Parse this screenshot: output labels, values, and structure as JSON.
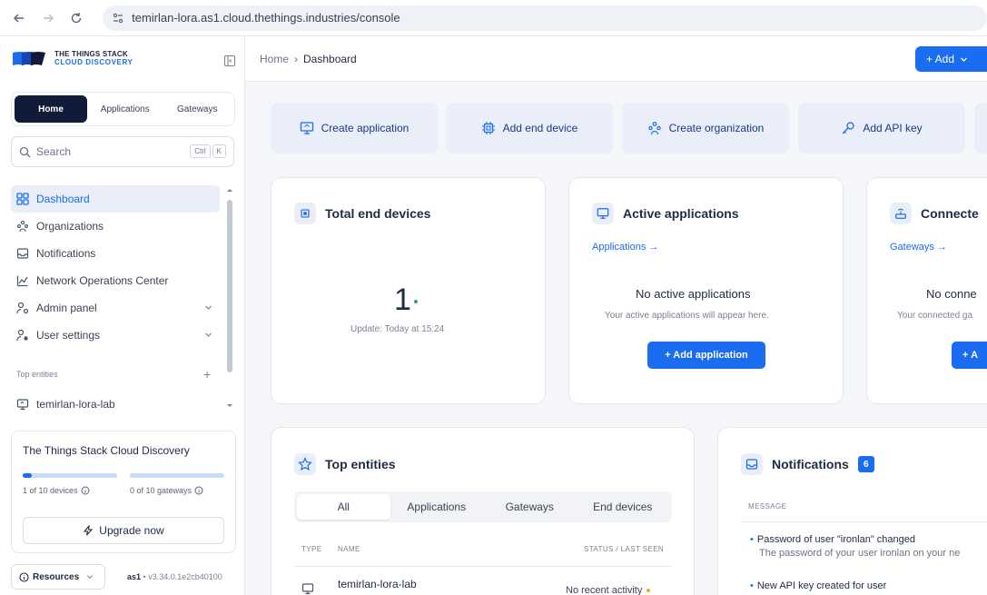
{
  "browser": {
    "url": "temirlan-lora.as1.cloud.thethings.industries/console"
  },
  "sidebar": {
    "logo_line1": "THE THINGS STACK",
    "logo_line2": "CLOUD DISCOVERY",
    "segments": [
      "Home",
      "Applications",
      "Gateways"
    ],
    "search_placeholder": "Search",
    "shortcut_keys": [
      "Ctrl",
      "K"
    ],
    "nav": [
      {
        "label": "Dashboard",
        "icon": "dashboard-icon",
        "active": true
      },
      {
        "label": "Organizations",
        "icon": "organizations-icon"
      },
      {
        "label": "Notifications",
        "icon": "inbox-icon"
      },
      {
        "label": "Network Operations Center",
        "icon": "chart-icon"
      },
      {
        "label": "Admin panel",
        "icon": "admin-icon",
        "expandable": true
      },
      {
        "label": "User settings",
        "icon": "user-settings-icon",
        "expandable": true
      }
    ],
    "top_entities_label": "Top entities",
    "top_entity_item": "temirlan-lora-lab",
    "plan": {
      "title": "The Things Stack Cloud Discovery",
      "devices_caption": "1 of 10 devices",
      "devices_fraction": 0.1,
      "gateways_caption": "0 of 10 gateways",
      "gateways_fraction": 0,
      "upgrade_label": "Upgrade now"
    },
    "resources_label": "Resources",
    "version_cluster": "as1",
    "version_text": "v3.34.0.1e2cb40100"
  },
  "topbar": {
    "breadcrumb_home": "Home",
    "breadcrumb_current": "Dashboard",
    "add_label": "+ Add"
  },
  "quick_actions": [
    "Create application",
    "Add end device",
    "Create organization",
    "Add API key"
  ],
  "cards": {
    "total_devices": {
      "title": "Total end devices",
      "value": "1",
      "update": "Update: Today at 15:24"
    },
    "active_apps": {
      "title": "Active applications",
      "link": "Applications →",
      "empty_title": "No active applications",
      "empty_desc": "Your active applications will appear here.",
      "button": "+ Add application"
    },
    "connected": {
      "title": "Connecte",
      "link": "Gateways →",
      "empty_title": "No conne",
      "empty_desc": "Your connected ga",
      "button": "+ A"
    }
  },
  "top_entities": {
    "title": "Top entities",
    "tabs": [
      "All",
      "Applications",
      "Gateways",
      "End devices"
    ],
    "col_type": "TYPE",
    "col_name": "NAME",
    "col_status": "STATUS / LAST SEEN",
    "row_name": "temirlan-lora-lab",
    "row_status": "No recent activity"
  },
  "notifications": {
    "title": "Notifications",
    "count": "6",
    "col_message": "MESSAGE",
    "items": [
      {
        "title": "Password of user \"ironlan\" changed",
        "desc": "The password of your user ironlan on your ne"
      },
      {
        "title": "New API key created for user",
        "desc": ""
      }
    ]
  },
  "colors": {
    "accent": "#1a6cf0",
    "nav_dark": "#0f1b38",
    "status_green": "#27a863",
    "status_amber": "#f0a52c"
  }
}
